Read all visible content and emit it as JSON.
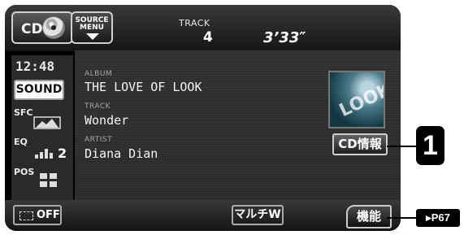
{
  "top_bar": {
    "source_label": "CD",
    "source_menu": [
      "SOURCE",
      "MENU"
    ],
    "track_heading": "TRACK",
    "track_number": "4",
    "elapsed_time": "3’33″"
  },
  "sidebar": {
    "clock": "12:48",
    "sound": "SOUND",
    "sfc": "SFC",
    "eq": "EQ",
    "eq_value": "2",
    "pos": "POS"
  },
  "info": {
    "album_label": "ALBUM",
    "album": "THE LOVE OF LOOK",
    "track_label": "TRACK",
    "track": "Wonder",
    "artist_label": "ARTIST",
    "artist": "Diana Dian"
  },
  "cd_info_button": "CD情報",
  "bottom_bar": {
    "off": "OFF",
    "multi": "マルチW",
    "function": "機能"
  },
  "callouts": {
    "number": "1",
    "page_ref": "P67"
  },
  "colors": {
    "screen": "#000000",
    "panel": "#2d2d2d",
    "text": "#ffffff",
    "label": "#a8a8a8"
  },
  "icons": [
    "cd-disc-icon",
    "down-arrow-icon",
    "sfc-icon",
    "eq-icon",
    "pos-icon",
    "off-indicator-icon",
    "play-arrow-icon"
  ]
}
